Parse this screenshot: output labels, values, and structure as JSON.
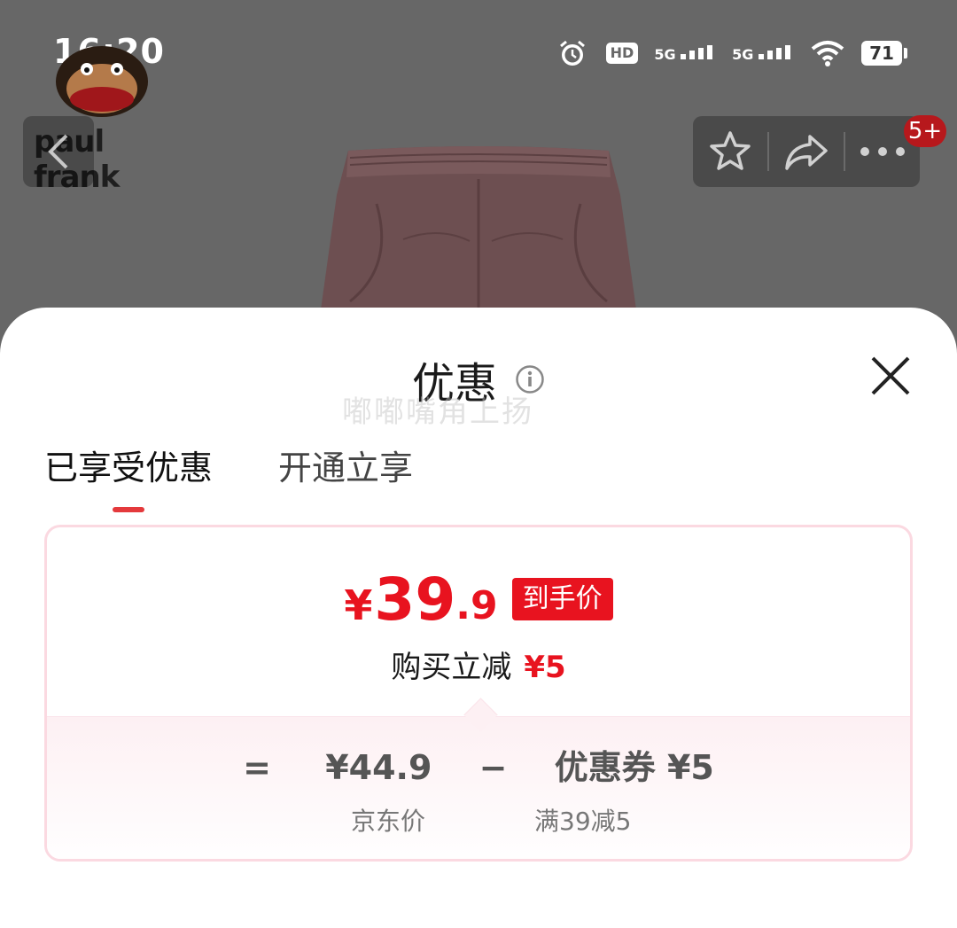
{
  "status_bar": {
    "time": "16:20",
    "battery": "71",
    "signal1": "5G",
    "signal2": "5G",
    "hd": "HD"
  },
  "brand": {
    "logo_text": "paul frank"
  },
  "header": {
    "cart_badge": "5+"
  },
  "sheet": {
    "title": "优惠",
    "watermark": "嘟嘟嘴角上扬",
    "tabs": [
      {
        "label": "已享受优惠",
        "active": true
      },
      {
        "label": "开通立享",
        "active": false
      }
    ]
  },
  "price": {
    "currency": "¥",
    "integer": "39",
    "decimal": ".9",
    "tag": "到手价",
    "reduce_label": "购买立减",
    "reduce_amount": "¥5"
  },
  "formula": {
    "eq": "=",
    "base_price": "¥44.9",
    "minus": "−",
    "coupon": "优惠券 ¥5",
    "base_label": "京东价",
    "coupon_label": "满39减5"
  },
  "colors": {
    "accent": "#e8131f",
    "tab_underline": "#e4393c",
    "card_border": "#fbd9e1"
  },
  "icons": [
    "back-icon",
    "star-icon",
    "share-icon",
    "more-icon",
    "info-icon",
    "close-icon",
    "alarm-icon",
    "wifi-icon"
  ]
}
